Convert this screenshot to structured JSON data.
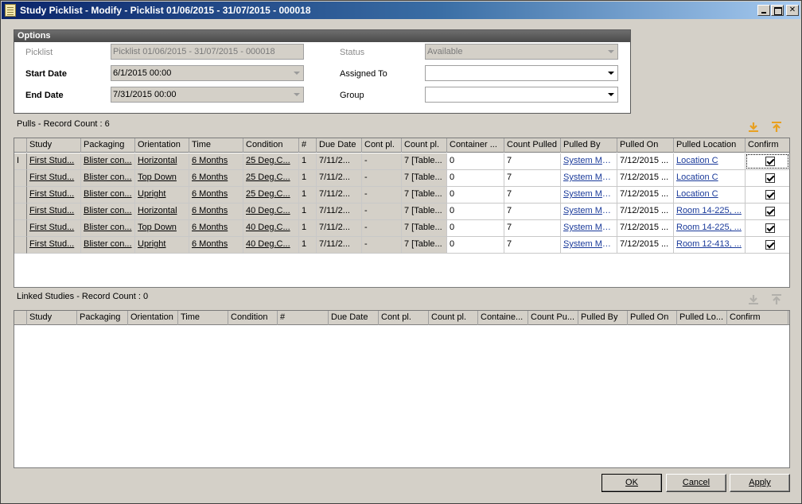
{
  "window": {
    "title": "Study Picklist - Modify - Picklist 01/06/2015 - 31/07/2015 - 000018"
  },
  "options": {
    "header": "Options",
    "picklist_label": "Picklist",
    "picklist_value": "Picklist 01/06/2015 - 31/07/2015 - 000018",
    "start_label": "Start Date",
    "start_value": "6/1/2015 00:00",
    "end_label": "End Date",
    "end_value": "7/31/2015 00:00",
    "status_label": "Status",
    "status_value": "Available",
    "assigned_label": "Assigned To",
    "assigned_value": "",
    "group_label": "Group",
    "group_value": ""
  },
  "pulls": {
    "label": "Pulls - Record Count : 6",
    "columns": [
      "Study",
      "Packaging",
      "Orientation",
      "Time",
      "Condition",
      "#",
      "Due Date",
      "Cont pl.",
      "Count pl.",
      "Container ...",
      "Count Pulled",
      "Pulled By",
      "Pulled On",
      "Pulled Location",
      "Confirm"
    ],
    "rows": [
      {
        "selector": "I",
        "study": "First Stud...",
        "packaging": "Blister con...",
        "orientation": "Horizontal",
        "time": "6 Months",
        "condition": "25 Deg.C...",
        "num": "1",
        "due": "7/11/2...",
        "cont": "-",
        "count": "7 [Table...",
        "container": "0",
        "pulled": "7",
        "by": "System Ma...",
        "on": "7/12/2015 ...",
        "location": "Location C",
        "confirm": true
      },
      {
        "selector": "",
        "study": "First Stud...",
        "packaging": "Blister con...",
        "orientation": "Top Down",
        "time": "6 Months",
        "condition": "25 Deg.C...",
        "num": "1",
        "due": "7/11/2...",
        "cont": "-",
        "count": "7 [Table...",
        "container": "0",
        "pulled": "7",
        "by": "System Ma...",
        "on": "7/12/2015 ...",
        "location": "Location C",
        "confirm": true
      },
      {
        "selector": "",
        "study": "First Stud...",
        "packaging": "Blister con...",
        "orientation": "Upright",
        "time": "6 Months",
        "condition": "25 Deg.C...",
        "num": "1",
        "due": "7/11/2...",
        "cont": "-",
        "count": "7 [Table...",
        "container": "0",
        "pulled": "7",
        "by": "System Ma...",
        "on": "7/12/2015 ...",
        "location": "Location C",
        "confirm": true
      },
      {
        "selector": "",
        "study": "First Stud...",
        "packaging": "Blister con...",
        "orientation": "Horizontal",
        "time": "6 Months",
        "condition": "40 Deg.C...",
        "num": "1",
        "due": "7/11/2...",
        "cont": "-",
        "count": "7 [Table...",
        "container": "0",
        "pulled": "7",
        "by": "System Ma...",
        "on": "7/12/2015 ...",
        "location": "Room 14-225, ...",
        "confirm": true
      },
      {
        "selector": "",
        "study": "First Stud...",
        "packaging": "Blister con...",
        "orientation": "Top Down",
        "time": "6 Months",
        "condition": "40 Deg.C...",
        "num": "1",
        "due": "7/11/2...",
        "cont": "-",
        "count": "7 [Table...",
        "container": "0",
        "pulled": "7",
        "by": "System Ma...",
        "on": "7/12/2015 ...",
        "location": "Room 14-225, ...",
        "confirm": true
      },
      {
        "selector": "",
        "study": "First Stud...",
        "packaging": "Blister con...",
        "orientation": "Upright",
        "time": "6 Months",
        "condition": "40 Deg.C...",
        "num": "1",
        "due": "7/11/2...",
        "cont": "-",
        "count": "7 [Table...",
        "container": "0",
        "pulled": "7",
        "by": "System Ma...",
        "on": "7/12/2015 ...",
        "location": "Room 12-413, ...",
        "confirm": true
      }
    ]
  },
  "linked": {
    "label": "Linked Studies - Record Count : 0",
    "columns": [
      "Study",
      "Packaging",
      "Orientation",
      "Time",
      "Condition",
      "#",
      "Due Date",
      "Cont pl.",
      "Count pl.",
      "Containe...",
      "Count Pu...",
      "Pulled By",
      "Pulled On",
      "Pulled Lo...",
      "Confirm"
    ]
  },
  "buttons": {
    "ok": "OK",
    "cancel": "Cancel",
    "apply": "Apply"
  },
  "icons": {
    "download": "download-arrow-icon",
    "upload": "upload-arrow-icon"
  },
  "colors": {
    "title_start": "#0a246a",
    "title_end": "#a6caf0",
    "face": "#d4d0c8",
    "link_blue": "#1a3a9a",
    "icon_orange": "#e8a020"
  }
}
